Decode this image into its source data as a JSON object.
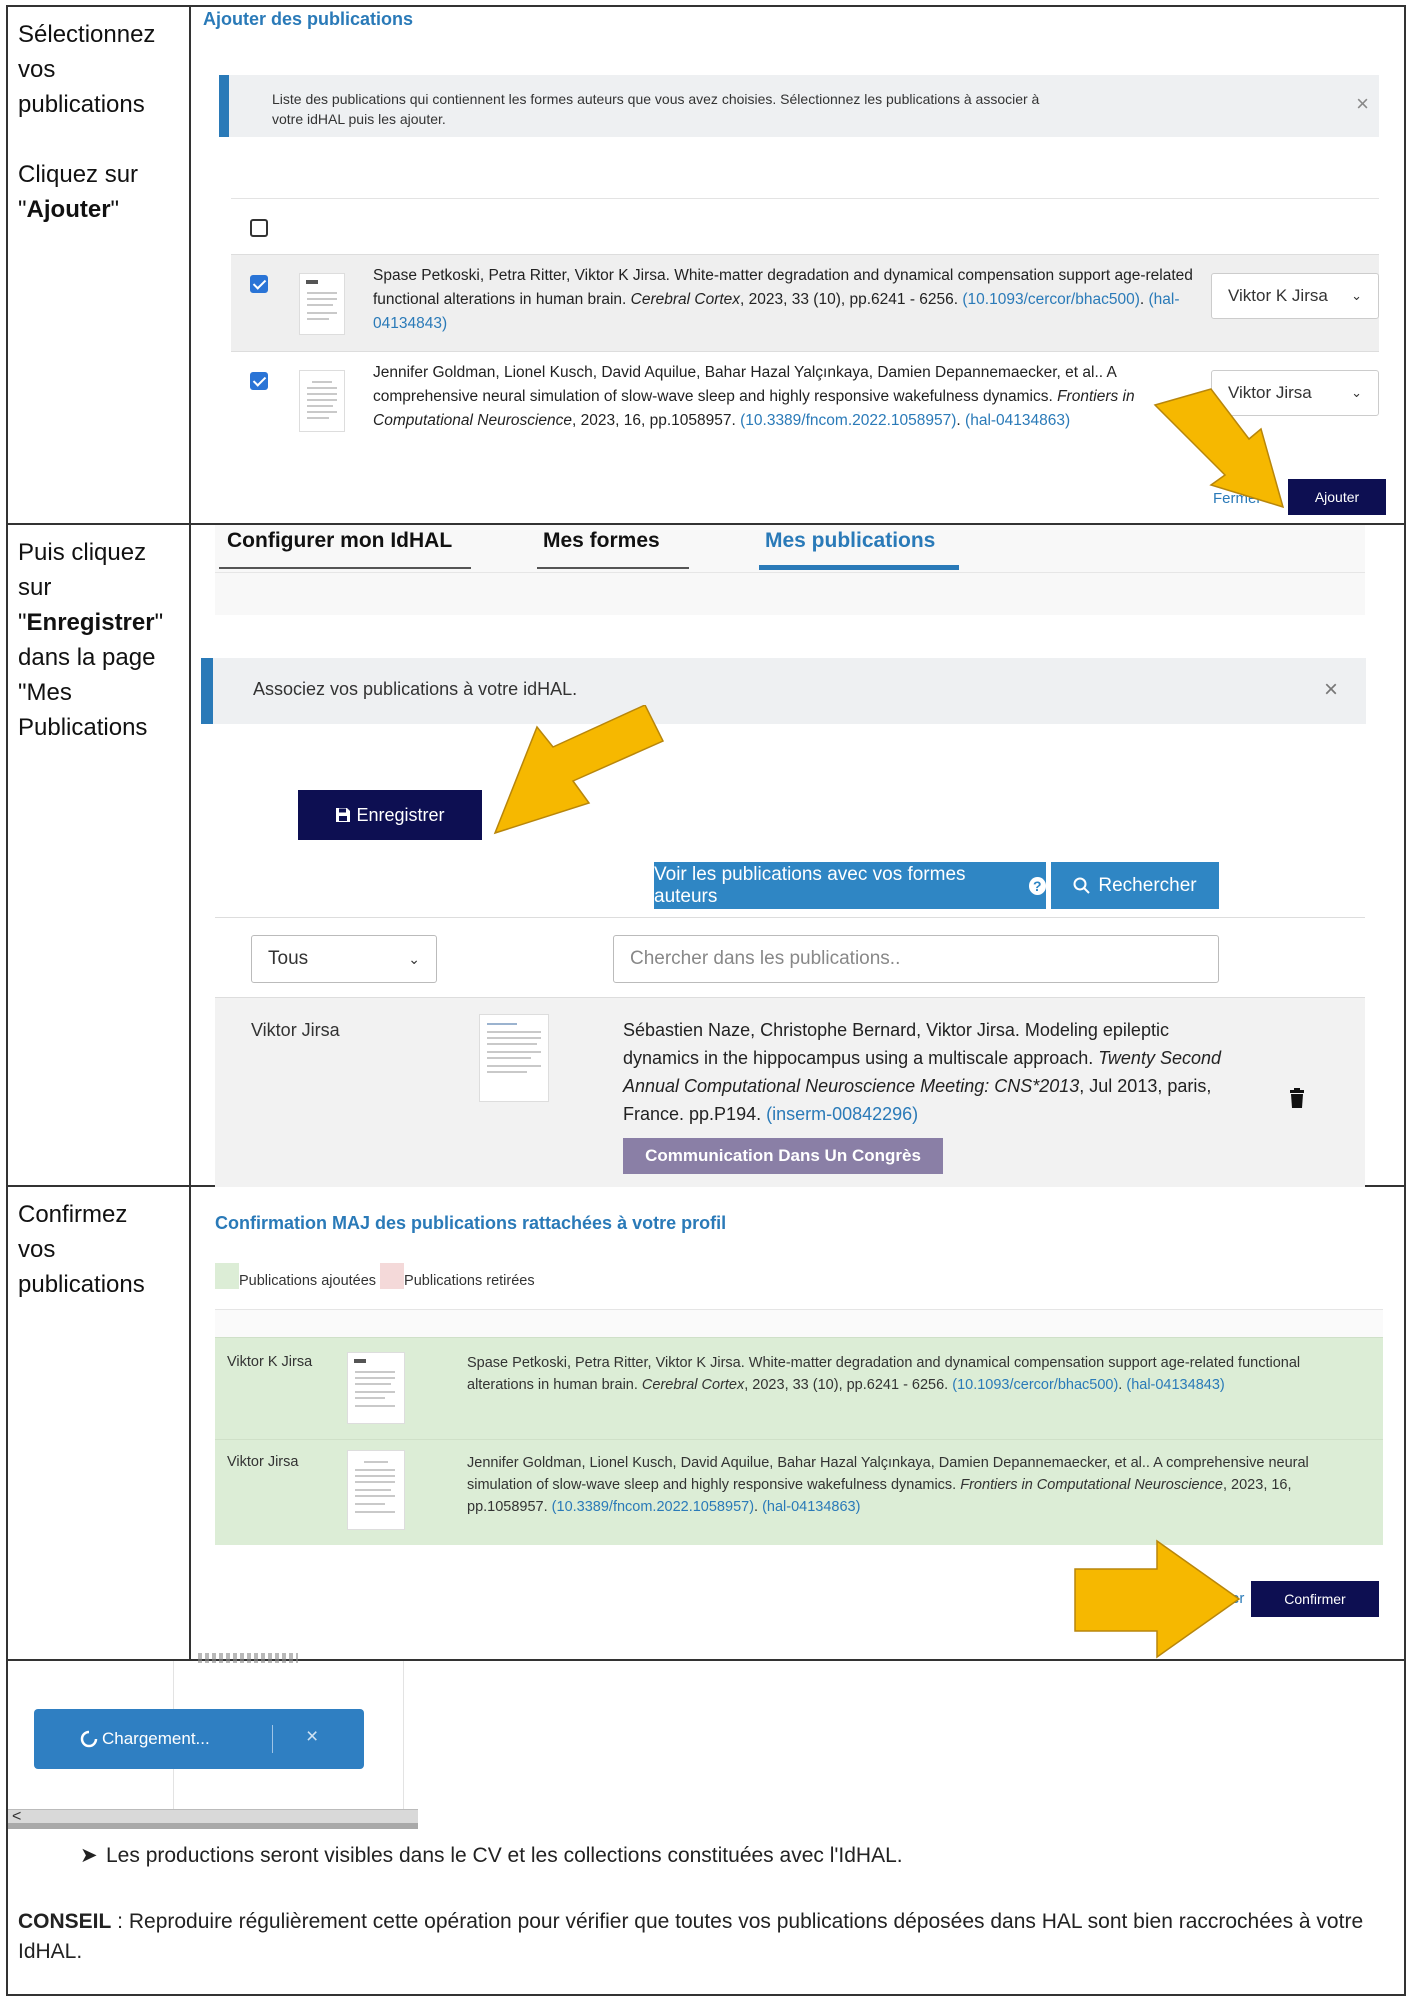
{
  "left_col": {
    "step1": {
      "line1": "Sélectionnez",
      "line2": "vos",
      "line3": "publications",
      "line4": "Cliquez sur",
      "quote_open": "\"",
      "bold": "Ajouter",
      "quote_close": "\""
    },
    "step2": {
      "line1": "Puis cliquez",
      "line2": "sur",
      "quote_open": "\"",
      "bold": "Enregistrer",
      "quote_close": "\"",
      "line4": "dans la page",
      "line5": "\"Mes",
      "line6": "Publications"
    },
    "step3": {
      "line1": "Confirmez",
      "line2": "vos",
      "line3": "publications"
    }
  },
  "panel1": {
    "title": "Ajouter des publications",
    "info": "Liste des publications qui contiennent les formes auteurs que vous avez choisies. Sélectionnez les publications à associer à votre idHAL puis les ajouter.",
    "close": "×",
    "pubs": [
      {
        "authors": "Spase Petkoski, Petra Ritter, Viktor K Jirsa. White-matter degradation and dynamical compensation support age-related functional alterations in human brain. ",
        "journal": "Cerebral Cortex",
        "rest": ", 2023, 33 (10), pp.6241 - 6256. ",
        "doi": "(10.1093/cercor/bhac500)",
        "sep": ". ",
        "hal": "(hal-04134843)",
        "select": "Viktor K Jirsa"
      },
      {
        "authors": "Jennifer Goldman, Lionel Kusch, David Aquilue, Bahar Hazal Yalçınkaya, Damien Depannemaecker, et al.. A comprehensive neural simulation of slow-wave sleep and highly responsive wakefulness dynamics. ",
        "journal": "Frontiers in Computational Neuroscience",
        "rest": ", 2023, 16, pp.1058957. ",
        "doi": "(10.3389/fncom.2022.1058957)",
        "sep": ". ",
        "hal": "(hal-04134863)",
        "select": "Viktor Jirsa"
      }
    ],
    "fermer": "Fermer",
    "ajouter": "Ajouter"
  },
  "panel2": {
    "tabs": [
      "Configurer mon IdHAL",
      "Mes formes",
      "Mes publications"
    ],
    "info": "Associez vos publications à votre idHAL.",
    "close": "×",
    "save": "Enregistrer",
    "voir": "Voir les publications avec vos formes auteurs",
    "rechercher": "Rechercher",
    "filter": "Tous",
    "search_placeholder": "Chercher dans les publications..",
    "row": {
      "author": "Viktor Jirsa",
      "text1": "Sébastien Naze, Christophe Bernard, Viktor Jirsa. Modeling epileptic dynamics in the hippocampus using a multiscale approach. ",
      "italic": "Twenty Second Annual Computational Neuroscience Meeting: CNS*2013",
      "text2": ", Jul 2013, paris, France. pp.P194. ",
      "link": "(inserm-00842296)",
      "badge": "Communication Dans Un Congrès"
    }
  },
  "panel3": {
    "title": "Confirmation MAJ des publications rattachées à votre profil",
    "legend_added": "Publications ajoutées",
    "legend_removed": "Publications retirées",
    "rows": [
      {
        "author": "Viktor K Jirsa",
        "text": "Spase Petkoski, Petra Ritter, Viktor K Jirsa. White-matter degradation and dynamical compensation support age-related functional alterations in human brain. ",
        "journal": "Cerebral Cortex",
        "rest": ", 2023, 33 (10), pp.6241 - 6256. ",
        "doi": "(10.1093/cercor/bhac500)",
        "sep": ". ",
        "hal": "(hal-04134843)"
      },
      {
        "author": "Viktor Jirsa",
        "text": "Jennifer Goldman, Lionel Kusch, David Aquilue, Bahar Hazal Yalçınkaya, Damien Depannemaecker, et al.. A comprehensive neural simulation of slow-wave sleep and highly responsive wakefulness dynamics. ",
        "journal": "Frontiers in Computational Neuroscience",
        "rest": ", 2023, 16, pp.1058957. ",
        "doi": "(10.3389/fncom.2022.1058957)",
        "sep": ". ",
        "hal": "(hal-04134863)"
      }
    ],
    "fermer_partial": "er",
    "confirmer": "Confirmer"
  },
  "bottom": {
    "loading": "Chargement...",
    "loading_close": "×",
    "scroll_left": "<",
    "bullet_text": "Les productions seront visibles dans le CV et les collections constituées avec l'IdHAL.",
    "tip_bold": "CONSEIL",
    "tip_text": " : Reproduire régulièrement cette opération pour vérifier que toutes vos publications déposées dans HAL sont bien raccrochées à votre IdHAL."
  },
  "colors": {
    "accent": "#2a7ab8",
    "navy": "#0d0f52",
    "arrow": "#f6b800",
    "badge": "#8a7fa6",
    "green": "#dcedd6"
  }
}
